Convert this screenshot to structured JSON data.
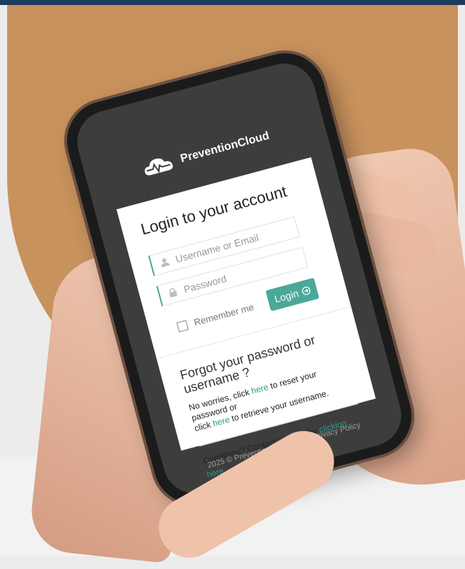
{
  "brand": {
    "name": "PreventionCloud",
    "icon": "cloud-pulse-icon"
  },
  "login": {
    "title": "Login to your account",
    "username_placeholder": "Username or Email",
    "password_placeholder": "Password",
    "remember_label": "Remember me",
    "login_label": "Login",
    "login_icon": "arrow-right-circle-icon"
  },
  "forgot": {
    "title": "Forgot your password or username ?",
    "line1_prefix": "No worries, click ",
    "line1_link": "here",
    "line1_suffix": " to reset your password or",
    "line2_prefix": "click ",
    "line2_link": "here",
    "line2_suffix": " to retrieve your username."
  },
  "support": {
    "prefix": "Questions? Contact support by ",
    "link": "clicking here",
    "suffix": "."
  },
  "footer": {
    "text": "2025 © PreventionCloud.com | Privacy Policy"
  },
  "colors": {
    "accent": "#4aa89a",
    "background_band": "#1d3b5e",
    "tan": "#c8925d",
    "screen_dark": "#3d3d3d"
  }
}
